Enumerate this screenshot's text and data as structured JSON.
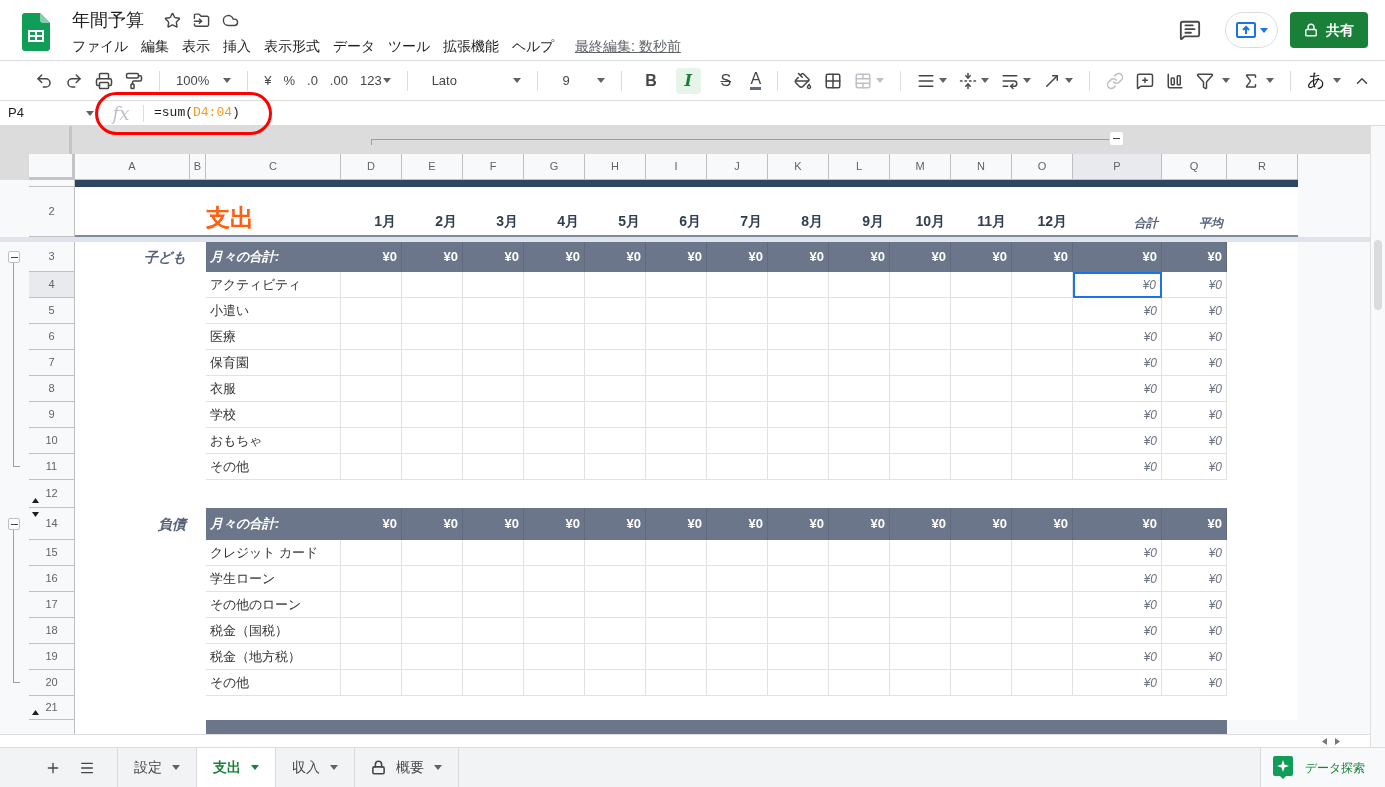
{
  "document": {
    "title": "年間予算",
    "menus": [
      "ファイル",
      "編集",
      "表示",
      "挿入",
      "表示形式",
      "データ",
      "ツール",
      "拡張機能",
      "ヘルプ"
    ],
    "last_edit": "最終編集: 数秒前",
    "share": "共有"
  },
  "toolbar": {
    "zoom": "100%",
    "currency": "¥",
    "percent": "%",
    "decimal_decrease": ".0",
    "decimal_increase": ".00",
    "number_format": "123",
    "font": "Lato",
    "font_size": "9",
    "styles": [
      {
        "kind": "bold",
        "label": "B",
        "selected": false
      },
      {
        "kind": "italic",
        "label": "I",
        "selected": true
      },
      {
        "kind": "strikethrough",
        "label": "S",
        "selected": false
      }
    ],
    "text_color": "A",
    "input_tool": "あ"
  },
  "formula_bar": {
    "cell_ref": "P4",
    "fx": "fx",
    "formula_start": "=sum(",
    "formula_range": "D4:04",
    "formula_end": ")"
  },
  "columns": [
    {
      "label": "A",
      "selected": false
    },
    {
      "label": "B",
      "selected": false
    },
    {
      "label": "C",
      "selected": false
    },
    {
      "label": "D",
      "selected": false
    },
    {
      "label": "E",
      "selected": false
    },
    {
      "label": "F",
      "selected": false
    },
    {
      "label": "G",
      "selected": false
    },
    {
      "label": "H",
      "selected": false
    },
    {
      "label": "I",
      "selected": false
    },
    {
      "label": "J",
      "selected": false
    },
    {
      "label": "K",
      "selected": false
    },
    {
      "label": "L",
      "selected": false
    },
    {
      "label": "M",
      "selected": false
    },
    {
      "label": "N",
      "selected": false
    },
    {
      "label": "O",
      "selected": false
    },
    {
      "label": "P",
      "selected": true
    },
    {
      "label": "Q",
      "selected": false
    },
    {
      "label": "R",
      "selected": false
    }
  ],
  "sheet": {
    "title_row": "2",
    "title": "支出",
    "months": [
      "1月",
      "2月",
      "3月",
      "4月",
      "5月",
      "6月",
      "7月",
      "8月",
      "9月",
      "10月",
      "11月",
      "12月"
    ],
    "total_label": "合計",
    "average_label": "平均",
    "sections": [
      {
        "category": "子ども",
        "header_row": "3",
        "total_label": "月々の合計:",
        "expanded": true,
        "values": [
          "¥0",
          "¥0",
          "¥0",
          "¥0",
          "¥0",
          "¥0",
          "¥0",
          "¥0",
          "¥0",
          "¥0",
          "¥0",
          "¥0"
        ],
        "total": "¥0",
        "average": "¥0",
        "gap_row": "12",
        "rows": [
          {
            "row": "4",
            "label": "アクティビティ",
            "total": "¥0",
            "average": "¥0",
            "selected": true
          },
          {
            "row": "5",
            "label": "小遣い",
            "total": "¥0",
            "average": "¥0",
            "selected": false
          },
          {
            "row": "6",
            "label": "医療",
            "total": "¥0",
            "average": "¥0",
            "selected": false
          },
          {
            "row": "7",
            "label": "保育園",
            "total": "¥0",
            "average": "¥0",
            "selected": false
          },
          {
            "row": "8",
            "label": "衣服",
            "total": "¥0",
            "average": "¥0",
            "selected": false
          },
          {
            "row": "9",
            "label": "学校",
            "total": "¥0",
            "average": "¥0",
            "selected": false
          },
          {
            "row": "10",
            "label": "おもちゃ",
            "total": "¥0",
            "average": "¥0",
            "selected": false
          },
          {
            "row": "11",
            "label": "その他",
            "total": "¥0",
            "average": "¥0",
            "selected": false
          }
        ]
      },
      {
        "category": "負債",
        "header_row": "14",
        "total_label": "月々の合計:",
        "expanded": true,
        "values": [
          "¥0",
          "¥0",
          "¥0",
          "¥0",
          "¥0",
          "¥0",
          "¥0",
          "¥0",
          "¥0",
          "¥0",
          "¥0",
          "¥0"
        ],
        "total": "¥0",
        "average": "¥0",
        "gap_row": "21",
        "rows": [
          {
            "row": "15",
            "label": "クレジット カード",
            "total": "¥0",
            "average": "¥0",
            "selected": false
          },
          {
            "row": "16",
            "label": "学生ローン",
            "total": "¥0",
            "average": "¥0",
            "selected": false
          },
          {
            "row": "17",
            "label": "その他のローン",
            "total": "¥0",
            "average": "¥0",
            "selected": false
          },
          {
            "row": "18",
            "label": "税金（国税）",
            "total": "¥0",
            "average": "¥0",
            "selected": false
          },
          {
            "row": "19",
            "label": "税金（地方税）",
            "total": "¥0",
            "average": "¥0",
            "selected": false
          },
          {
            "row": "20",
            "label": "その他",
            "total": "¥0",
            "average": "¥0",
            "selected": false
          }
        ]
      }
    ]
  },
  "tabs": [
    {
      "label": "設定",
      "selected": false,
      "locked": false
    },
    {
      "label": "支出",
      "selected": true,
      "locked": false
    },
    {
      "label": "収入",
      "selected": false,
      "locked": false
    },
    {
      "label": "概要",
      "selected": false,
      "locked": true
    }
  ],
  "explore": "データ探索"
}
